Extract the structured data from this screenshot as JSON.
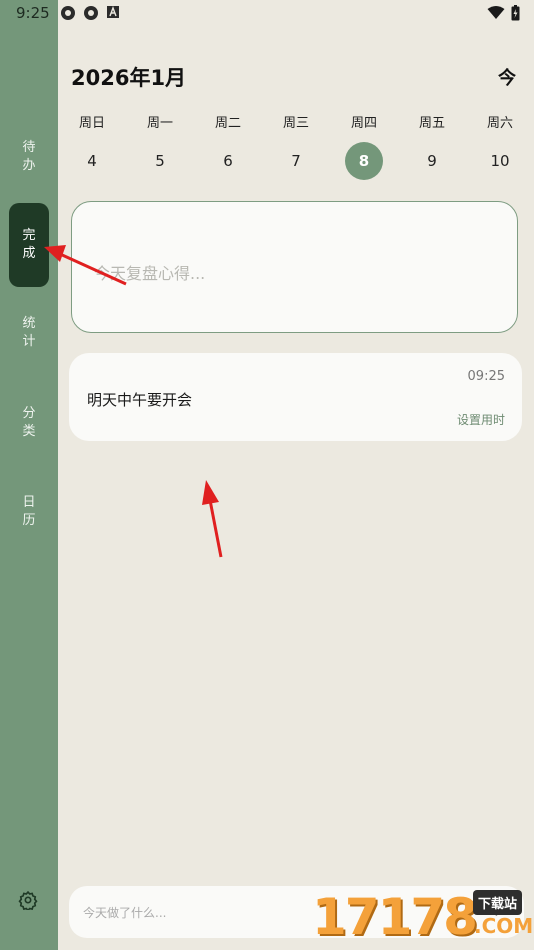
{
  "status_bar": {
    "time": "9:25"
  },
  "sidebar": {
    "items": [
      {
        "id": "todo",
        "label_chars": [
          "待",
          "办"
        ]
      },
      {
        "id": "done",
        "label_chars": [
          "完",
          "成"
        ],
        "active": true
      },
      {
        "id": "stats",
        "label_chars": [
          "统",
          "计"
        ]
      },
      {
        "id": "category",
        "label_chars": [
          "分",
          "类"
        ]
      },
      {
        "id": "calendar",
        "label_chars": [
          "日",
          "历"
        ]
      }
    ]
  },
  "header": {
    "month_title": "2026年1月",
    "today_label": "今"
  },
  "week": {
    "days": [
      {
        "name": "周日",
        "num": "4"
      },
      {
        "name": "周一",
        "num": "5"
      },
      {
        "name": "周二",
        "num": "6"
      },
      {
        "name": "周三",
        "num": "7"
      },
      {
        "name": "周四",
        "num": "8",
        "selected": true
      },
      {
        "name": "周五",
        "num": "9"
      },
      {
        "name": "周六",
        "num": "10"
      }
    ]
  },
  "review": {
    "placeholder": "今天复盘心得..."
  },
  "task": {
    "time": "09:25",
    "text": "明天中午要开会",
    "duration_label": "设置用时"
  },
  "input": {
    "placeholder": "今天做了什么...",
    "add_symbol": "+"
  },
  "watermark": {
    "numbers": "17178",
    "site": "下载站",
    "domain": ".COM"
  },
  "colors": {
    "sidebar": "#74977A",
    "active": "#1F3A26",
    "background": "#ECE9E0",
    "accent": "#6E8B72"
  }
}
